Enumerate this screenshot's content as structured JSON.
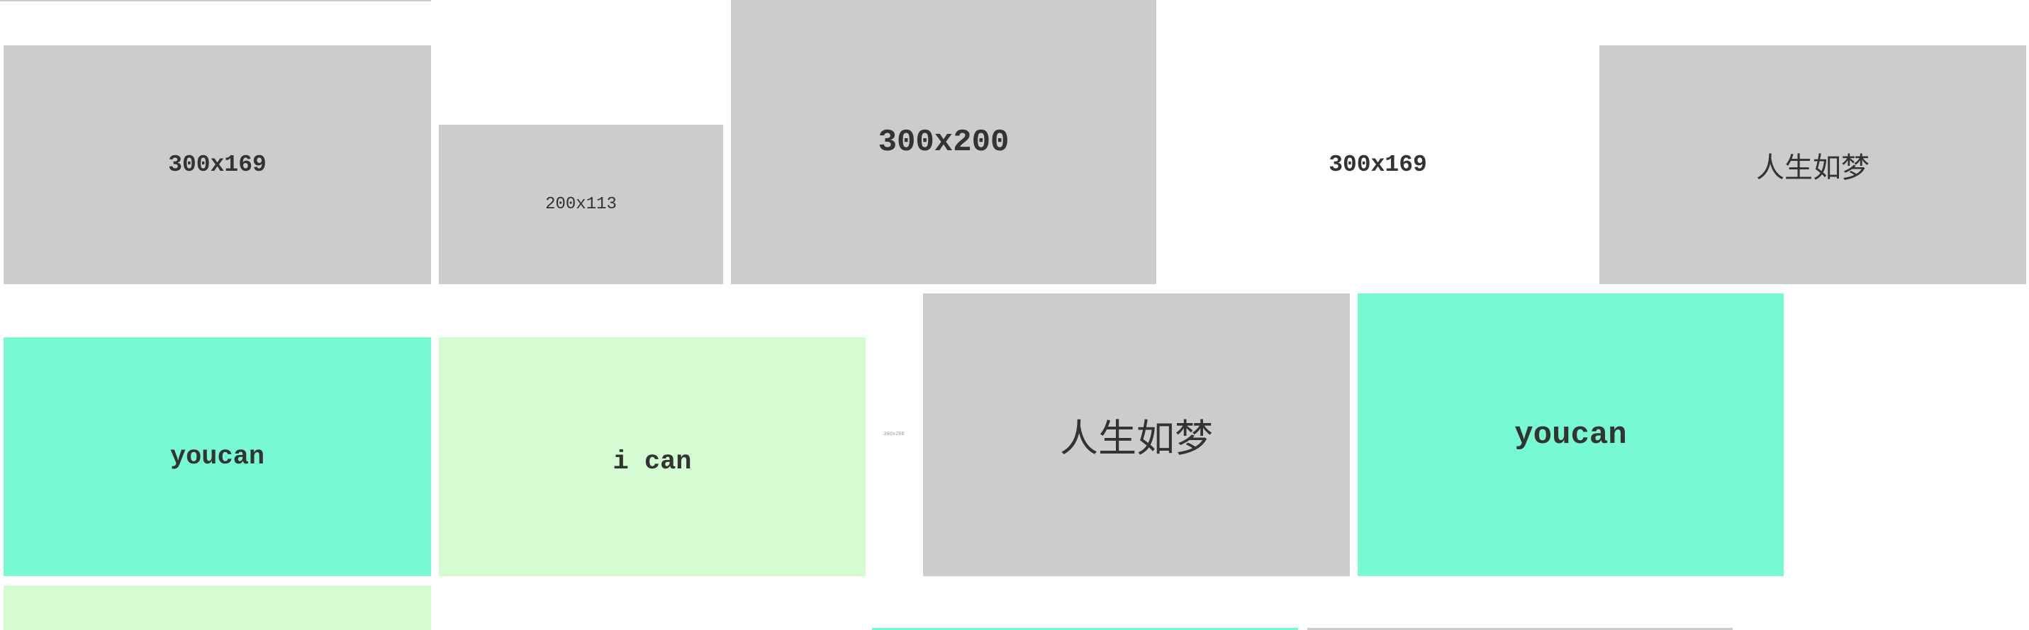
{
  "colors": {
    "gray": "#cccccc",
    "green": "#77f9d1",
    "light_green": "#d5fbd2",
    "text": "#333333"
  },
  "tiles": [
    {
      "label": "300x169"
    },
    {
      "label": "200x113"
    },
    {
      "label": "300x200"
    },
    {
      "label": "300x169"
    },
    {
      "label": "人生如梦"
    },
    {
      "label": "youcan"
    },
    {
      "label": "i can"
    },
    {
      "label": "300x200"
    },
    {
      "label": "人生如梦"
    },
    {
      "label": "youcan"
    }
  ]
}
